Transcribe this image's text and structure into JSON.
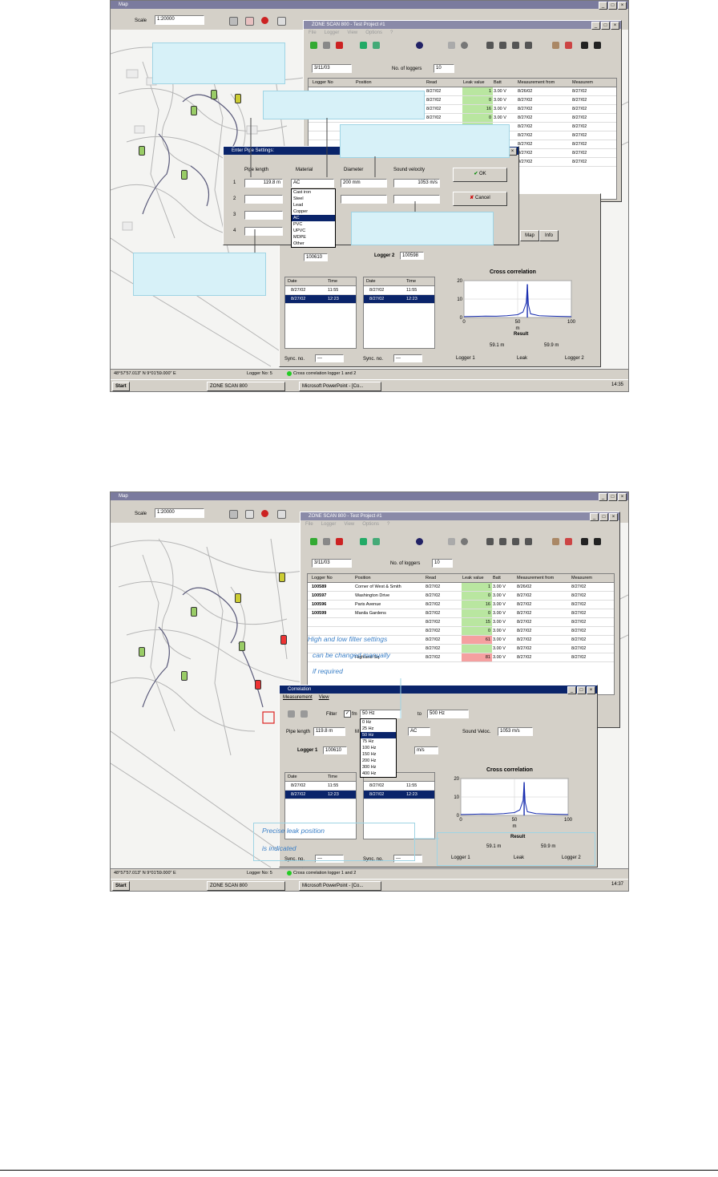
{
  "shot1": {
    "map_title": "Map",
    "scale_label": "Scale",
    "scale_value": "1:20000",
    "coords": "48°57'57.013\" N   9°01'59.000\" E",
    "logger_no": "Logger No: 5",
    "status_msg": "Cross correlation logger 1 and 2",
    "list_window": {
      "title": "ZONE SCAN 800 - Test Project #1",
      "menu": [
        "File",
        "Logger",
        "View",
        "Options",
        "?"
      ],
      "date": "3/11/03",
      "num_loggers_label": "No. of loggers",
      "num_loggers": "10",
      "columns": [
        "Logger No",
        "Position",
        "Read",
        "Leak value",
        "Batt",
        "Measurement from",
        "Measurem"
      ],
      "rows": [
        [
          "",
          "",
          "8/27/02",
          "1",
          "3.00 V",
          "8/26/02",
          "8/27/02"
        ],
        [
          "",
          "",
          "8/27/02",
          "0",
          "3.00 V",
          "8/27/02",
          "8/27/02"
        ],
        [
          "",
          "",
          "8/27/02",
          "16",
          "3.00 V",
          "8/27/02",
          "8/27/02"
        ],
        [
          "",
          "",
          "8/27/02",
          "0",
          "3.00 V",
          "8/27/02",
          "8/27/02"
        ],
        [
          "",
          "",
          "8/27/02",
          "",
          "3.00 V",
          "8/27/02",
          "8/27/02"
        ],
        [
          "",
          "",
          "8/27/02",
          "",
          "3.00 V",
          "8/27/02",
          "8/27/02"
        ],
        [
          "",
          "",
          "8/27/02",
          "",
          "3.00 V",
          "8/27/02",
          "8/27/02"
        ],
        [
          "",
          "",
          "8/27/02",
          "",
          "3.00 V",
          "8/27/02",
          "8/27/02"
        ],
        [
          "",
          "",
          "8/27/02",
          "",
          "3.00 V",
          "8/27/02",
          "8/27/02"
        ]
      ]
    },
    "pipe_dialog": {
      "title": "Enter Pipe Settings:",
      "col_labels": [
        "Pipe length",
        "Material",
        "Diameter",
        "Sound velocity"
      ],
      "row_numbers": [
        "1",
        "2",
        "3",
        "4"
      ],
      "pipe_length": "119.8 m",
      "material": "AC",
      "diameter": "200 mm",
      "sound_velocity": "1053 m/s",
      "ok": "OK",
      "cancel": "Cancel",
      "material_options": [
        "Cast iron",
        "Steel",
        "Lead",
        "Copper",
        "AC",
        "PVC",
        "UPVC",
        "MDPE",
        "Other"
      ],
      "material_selected_index": 4
    },
    "correlation": {
      "logger2_label": "Logger 2",
      "logger2_value": "100598",
      "logger1_value": "100610",
      "table_headers": [
        "Date",
        "Time"
      ],
      "table1": [
        [
          "8/27/02",
          "11:55"
        ],
        [
          "8/27/02",
          "12:23"
        ]
      ],
      "table2": [
        [
          "8/27/02",
          "11:55"
        ],
        [
          "8/27/02",
          "12:23"
        ]
      ],
      "chart_title": "Cross correlation",
      "result_label": "Result",
      "result_left": "59.1 m",
      "result_right": "59.9 m",
      "logger1": "Logger 1",
      "leak": "Leak",
      "logger2": "Logger 2",
      "sync_label": "Sync. no.",
      "sync_value": "---",
      "tab_left": "Map",
      "tab_right": "Info"
    },
    "taskbar": {
      "start": "Start",
      "item1": "ZONE SCAN 800",
      "item2": "Microsoft PowerPoint - [Co...",
      "clock": "14:35"
    }
  },
  "shot2": {
    "map_title": "Map",
    "scale_label": "Scale",
    "scale_value": "1:20000",
    "coords": "48°57'57.013\" N   9°01'59.000\" E",
    "logger_no": "Logger No: 5",
    "status_msg": "Cross correlation logger 1 and 2",
    "list_window": {
      "title": "ZONE SCAN 800 - Test Project #1",
      "menu": [
        "File",
        "Logger",
        "View",
        "Options",
        "?"
      ],
      "date": "3/11/03",
      "num_loggers_label": "No. of loggers",
      "num_loggers": "10",
      "columns": [
        "Logger No",
        "Position",
        "Read",
        "Leak value",
        "Batt",
        "Measurement from",
        "Measurem"
      ],
      "rows": [
        [
          "100589",
          "Corner of West & Smith",
          "8/27/02",
          "1",
          "3.00 V",
          "8/26/02",
          "8/27/02"
        ],
        [
          "100597",
          "Washington Drive",
          "8/27/02",
          "0",
          "3.00 V",
          "8/27/02",
          "8/27/02"
        ],
        [
          "100596",
          "Paris Avenue",
          "8/27/02",
          "16",
          "3.00 V",
          "8/27/02",
          "8/27/02"
        ],
        [
          "100599",
          "Manila Gardens",
          "8/27/02",
          "0",
          "3.00 V",
          "8/27/02",
          "8/27/02"
        ],
        [
          "",
          "",
          "8/27/02",
          "15",
          "3.00 V",
          "8/27/02",
          "8/27/02"
        ],
        [
          "",
          "",
          "8/27/02",
          "0",
          "3.00 V",
          "8/27/02",
          "8/27/02"
        ],
        [
          "",
          "",
          "8/27/02",
          "61",
          "3.00 V",
          "8/27/02",
          "8/27/02"
        ],
        [
          "",
          "",
          "8/27/02",
          "",
          "3.00 V",
          "8/27/02",
          "8/27/02"
        ],
        [
          "",
          "Highland Sq.",
          "8/27/02",
          "81",
          "3.00 V",
          "8/27/02",
          "8/27/02"
        ]
      ]
    },
    "callout_top": [
      "High and low filter settings",
      "can be changed manually",
      "if required"
    ],
    "callout_bottom": [
      "Precise leak position",
      "is indicated"
    ],
    "correlation": {
      "title": "Correlation",
      "menu": [
        "Measurement",
        "View"
      ],
      "filter_label": "Filter",
      "filter_from_label": "fm",
      "filter_from": "50 Hz",
      "filter_to_label": "to",
      "filter_to": "500 Hz",
      "filter_options": [
        "0 Hz",
        "25 Hz",
        "50 Hz",
        "75 Hz",
        "100 Hz",
        "150 Hz",
        "200 Hz",
        "300 Hz",
        "400 Hz"
      ],
      "filter_selected_index": 2,
      "pipe_length_label": "Pipe length",
      "pipe_length": "119.8 m",
      "material_label": "M",
      "material": "AC",
      "sound_velocity_label": "Sound Veloc.",
      "sound_velocity": "1053 m/s",
      "logger1_label": "Logger 1",
      "logger1_value": "100610",
      "logger2_value": "m/s",
      "table_headers": [
        "Date",
        "Time"
      ],
      "table2_header": "Date",
      "table1": [
        [
          "8/27/02",
          "11:55"
        ],
        [
          "8/27/02",
          "12:23"
        ]
      ],
      "table2": [
        [
          "8/27/02",
          "11:55"
        ],
        [
          "8/27/02",
          "12:23"
        ]
      ],
      "chart_title": "Cross correlation",
      "result_label": "Result",
      "result_left": "59.1 m",
      "result_right": "59.9 m",
      "logger1": "Logger 1",
      "leak": "Leak",
      "logger2": "Logger 2",
      "sync_label": "Sync. no.",
      "sync_value": "---"
    },
    "taskbar": {
      "start": "Start",
      "item1": "ZONE SCAN 800",
      "item2": "Microsoft PowerPoint - [Co...",
      "clock": "14:37"
    }
  },
  "chart_data": [
    {
      "type": "line",
      "title": "Cross correlation",
      "xlabel": "m",
      "ylabel": "",
      "xlim": [
        0,
        100
      ],
      "ylim": [
        0,
        20
      ],
      "x_ticks": [
        "0",
        "50",
        "100"
      ],
      "y_ticks": [
        "0",
        "10",
        "20"
      ],
      "peak": {
        "x": 59,
        "y": 18
      },
      "series": [
        {
          "x": [
            0,
            10,
            20,
            30,
            40,
            50,
            55,
            58,
            59,
            60,
            62,
            70,
            80,
            90,
            100
          ],
          "values": [
            0.5,
            0.6,
            0.8,
            0.7,
            1.0,
            1.5,
            3,
            8,
            18,
            7,
            2,
            1,
            0.8,
            0.6,
            0.5
          ]
        }
      ]
    },
    {
      "type": "line",
      "title": "Cross correlation",
      "xlabel": "m",
      "ylabel": "",
      "xlim": [
        0,
        100
      ],
      "ylim": [
        0,
        20
      ],
      "x_ticks": [
        "0",
        "50",
        "100"
      ],
      "y_ticks": [
        "0",
        "10",
        "20"
      ],
      "peak": {
        "x": 59,
        "y": 18
      },
      "series": [
        {
          "x": [
            0,
            10,
            20,
            30,
            40,
            50,
            55,
            58,
            59,
            60,
            62,
            70,
            80,
            90,
            100
          ],
          "values": [
            0.5,
            0.6,
            0.8,
            0.7,
            1.0,
            1.5,
            3,
            8,
            18,
            7,
            2,
            1,
            0.8,
            0.6,
            0.5
          ]
        }
      ]
    }
  ]
}
